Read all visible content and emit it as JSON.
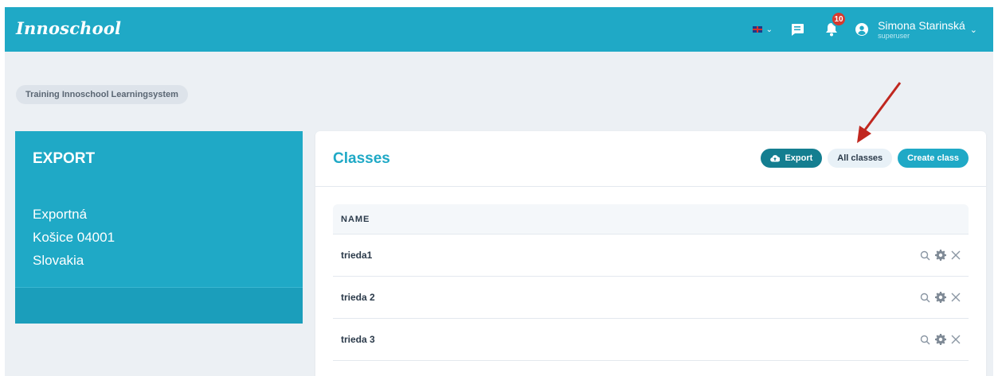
{
  "app": {
    "brand": "Innoschool",
    "notification_count": "10",
    "user_name": "Simona Starinská",
    "user_role": "superuser",
    "language_icon": "uk-flag-icon"
  },
  "breadcrumb": "Training Innoschool Learningsystem",
  "org_card": {
    "title": "EXPORT",
    "address_line1": "Exportná",
    "address_line2": "Košice 04001",
    "address_line3": "Slovakia"
  },
  "classes": {
    "title": "Classes",
    "buttons": {
      "export": "Export",
      "all_classes": "All classes",
      "create_class": "Create class"
    },
    "columns": [
      "NAME"
    ],
    "rows": [
      "trieda1",
      "trieda 2",
      "trieda 3"
    ]
  },
  "colors": {
    "brand": "#1fa9c6",
    "export_button": "#147e90",
    "badge": "#d63a2f",
    "annotation_arrow": "#c0271f"
  }
}
